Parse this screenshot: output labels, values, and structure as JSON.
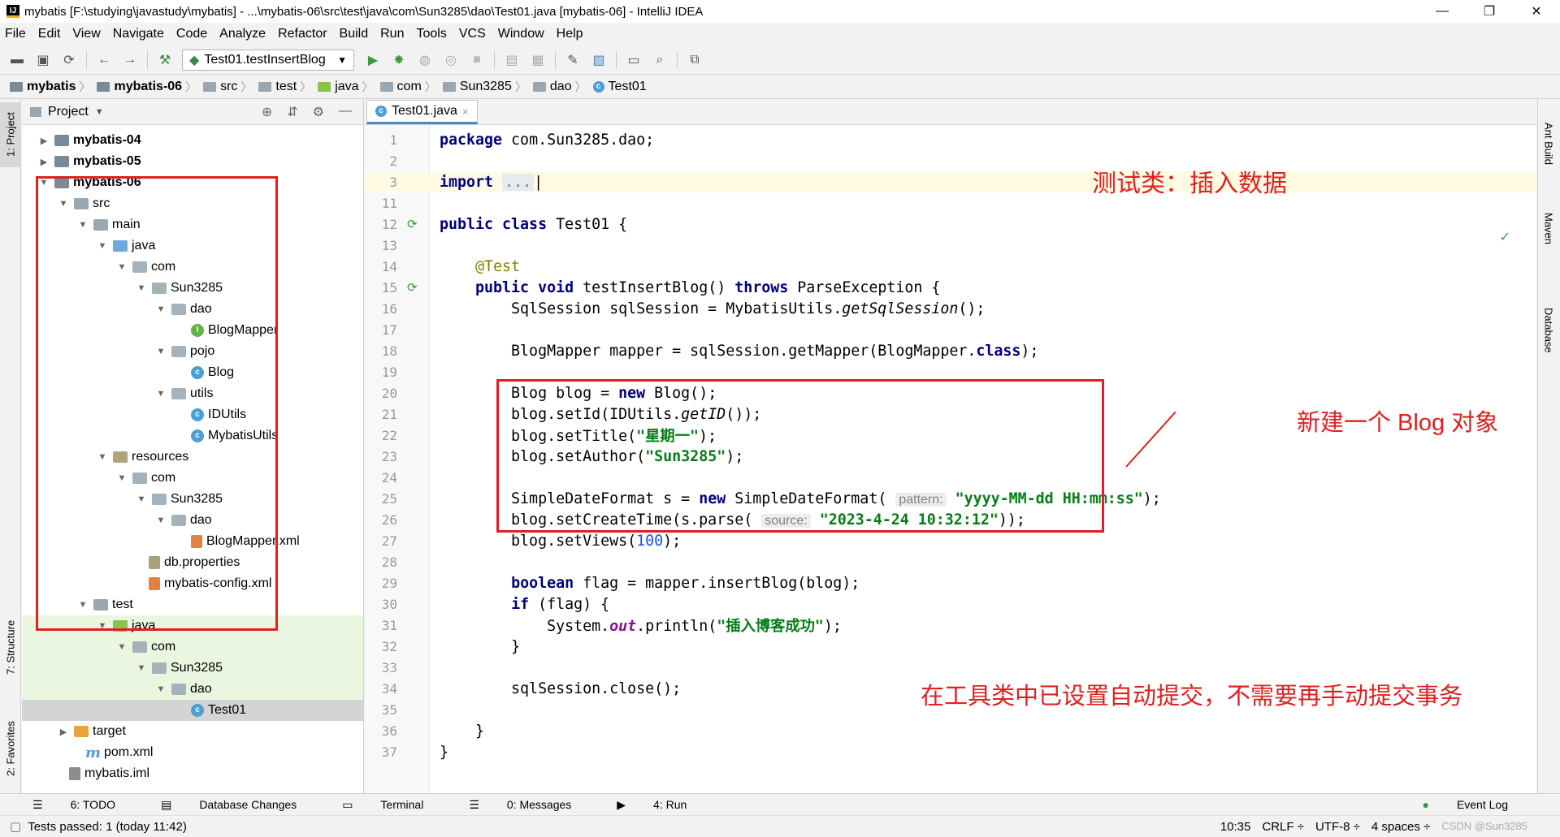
{
  "window": {
    "title": "mybatis [F:\\studying\\javastudy\\mybatis] - ...\\mybatis-06\\src\\test\\java\\com\\Sun3285\\dao\\Test01.java [mybatis-06] - IntelliJ IDEA",
    "minimize": "—",
    "maximize": "❐",
    "close": "✕"
  },
  "menu": [
    "File",
    "Edit",
    "View",
    "Navigate",
    "Code",
    "Analyze",
    "Refactor",
    "Build",
    "Run",
    "Tools",
    "VCS",
    "Window",
    "Help"
  ],
  "toolbar": {
    "run_config": "Test01.testInsertBlog"
  },
  "breadcrumbs": [
    "mybatis",
    "mybatis-06",
    "src",
    "test",
    "java",
    "com",
    "Sun3285",
    "dao",
    "Test01"
  ],
  "project_panel": {
    "title": "Project",
    "tree": [
      {
        "label": "mybatis-04",
        "bold": true
      },
      {
        "label": "mybatis-05",
        "bold": true
      },
      {
        "label": "mybatis-06",
        "bold": true
      },
      {
        "label": "src"
      },
      {
        "label": "main"
      },
      {
        "label": "java"
      },
      {
        "label": "com"
      },
      {
        "label": "Sun3285"
      },
      {
        "label": "dao"
      },
      {
        "label": "BlogMapper"
      },
      {
        "label": "pojo"
      },
      {
        "label": "Blog"
      },
      {
        "label": "utils"
      },
      {
        "label": "IDUtils"
      },
      {
        "label": "MybatisUtils"
      },
      {
        "label": "resources"
      },
      {
        "label": "com"
      },
      {
        "label": "Sun3285"
      },
      {
        "label": "dao"
      },
      {
        "label": "BlogMapper.xml"
      },
      {
        "label": "db.properties"
      },
      {
        "label": "mybatis-config.xml"
      },
      {
        "label": "test"
      },
      {
        "label": "java"
      },
      {
        "label": "com"
      },
      {
        "label": "Sun3285"
      },
      {
        "label": "dao"
      },
      {
        "label": "Test01"
      },
      {
        "label": "target"
      },
      {
        "label": "pom.xml"
      },
      {
        "label": "mybatis.iml"
      }
    ]
  },
  "left_tabs": {
    "project": "1: Project",
    "structure": "7: Structure",
    "favorites": "2: Favorites"
  },
  "right_tabs": {
    "ant": "Ant Build",
    "maven": "Maven",
    "database": "Database"
  },
  "editor": {
    "tab": "Test01.java",
    "line_numbers": [
      "1",
      "2",
      "3",
      "11",
      "12",
      "13",
      "14",
      "15",
      "16",
      "17",
      "18",
      "19",
      "20",
      "21",
      "22",
      "23",
      "24",
      "25",
      "26",
      "27",
      "28",
      "29",
      "30",
      "31",
      "32",
      "33",
      "34",
      "35",
      "36",
      "37"
    ],
    "hints": {
      "pattern": "pattern:",
      "source": "source:"
    },
    "strings": {
      "title": "\"星期一\"",
      "author": "\"Sun3285\"",
      "pattern": "\"yyyy-MM-dd HH:mm:ss\"",
      "date": "\"2023-4-24 10:32:12\"",
      "success": "\"插入博客成功\""
    },
    "numbers": {
      "views": "100"
    }
  },
  "annotations": {
    "test_class": "测试类：插入数据",
    "new_blog": "新建一个 Blog 对象",
    "auto_commit": "在工具类中已设置自动提交，不需要再手动提交事务"
  },
  "bottom_tools": [
    "6: TODO",
    "Database Changes",
    "Terminal",
    "0: Messages",
    "4: Run"
  ],
  "event_log": "Event Log",
  "status": {
    "message": "Tests passed: 1 (today 11:42)",
    "position": "10:35",
    "line_sep": "CRLF ÷",
    "encoding": "UTF-8 ÷",
    "indent": "4 spaces ÷",
    "watermark": "CSDN @Sun3285"
  },
  "colors": {
    "annotation_red": "#e02020",
    "test_green": "#eaf6df",
    "keyword": "#000080",
    "string": "#067d17"
  }
}
